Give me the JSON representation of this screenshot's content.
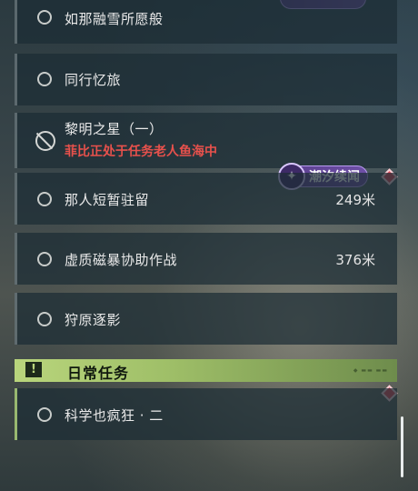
{
  "quests": [
    {
      "title": "如那融雪所愿般",
      "distance": "",
      "note": ""
    },
    {
      "title": "同行忆旅",
      "distance": "",
      "note": ""
    },
    {
      "title": "黎明之星（一）",
      "distance": "",
      "note": "菲比正处于任务老人鱼海中"
    },
    {
      "title": "那人短暂驻留",
      "distance": "249米",
      "note": ""
    },
    {
      "title": "虚质磁暴协助作战",
      "distance": "376米",
      "note": ""
    },
    {
      "title": "狩原逐影",
      "distance": "",
      "note": ""
    }
  ],
  "tag": {
    "label": "潮汐续闻",
    "icon": "tide-star-icon"
  },
  "section": {
    "title": "日常任务",
    "icon": "exclamation-icon"
  },
  "daily": [
    {
      "title": "科学也疯狂 · 二"
    }
  ],
  "colors": {
    "warn": "#e8514c",
    "section_green": "#b9d57c",
    "tag_purple": "#6e4fa6",
    "marker_red": "#e04858"
  }
}
